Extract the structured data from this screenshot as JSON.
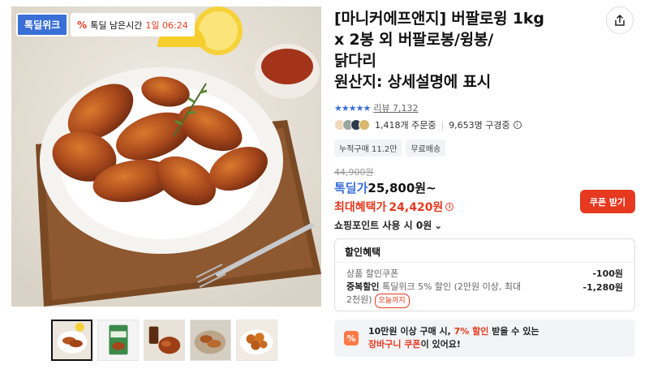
{
  "gallery": {
    "deal_logo": "톡딜위크",
    "timer_pct_icon": "%",
    "timer_label": "톡딜 남은시간",
    "timer_value": "1일 06:24",
    "thumbnails": [
      "thumb-1",
      "thumb-2",
      "thumb-3",
      "thumb-4",
      "thumb-5"
    ]
  },
  "product": {
    "title_lines": [
      "[마니커에프앤지] 버팔로윙 1kg",
      "x 2봉 외 버팔로봉/윙봉/",
      "닭다리",
      "원산지: 상세설명에 표시"
    ],
    "stars": "★★★★★",
    "review_label": "리뷰 7,132",
    "orders": "1,418개 주문중",
    "subscribers": "9,653명 구경중",
    "info_glyph": "i",
    "tags": [
      "누적구매 11.2만",
      "무료배송"
    ],
    "original_price": "44,900원",
    "deal_price_label": "톡딜가",
    "deal_price_value": "25,800원~",
    "max_benefit_label": "최대혜택가",
    "max_benefit_value": "24,420원",
    "coupon_button": "쿠폰 받기",
    "point_label": "쇼핑포인트 사용 시 0원",
    "point_chevron": "⌄"
  },
  "discount": {
    "header": "할인혜택",
    "row1_label": "상품 할인쿠폰",
    "row1_amount": "-100원",
    "row2_bold": "중복할인",
    "row2_text": " 톡딜위크 5% 할인 (2만원 이상, 최대",
    "row2_text2": "2천원)",
    "row2_tag": "오늘까지",
    "row2_amount": "-1,280원"
  },
  "promo": {
    "icon": "%",
    "line1_a": "10만원 이상 구매 시, ",
    "line1_hl": "7% 할인",
    "line1_b": " 받을 수 있는",
    "line2_a": "장바구니 쿠폰",
    "line2_b": "이 있어요!"
  },
  "colors": {
    "accent_blue": "#3a6fd8",
    "accent_red": "#e6391f"
  }
}
